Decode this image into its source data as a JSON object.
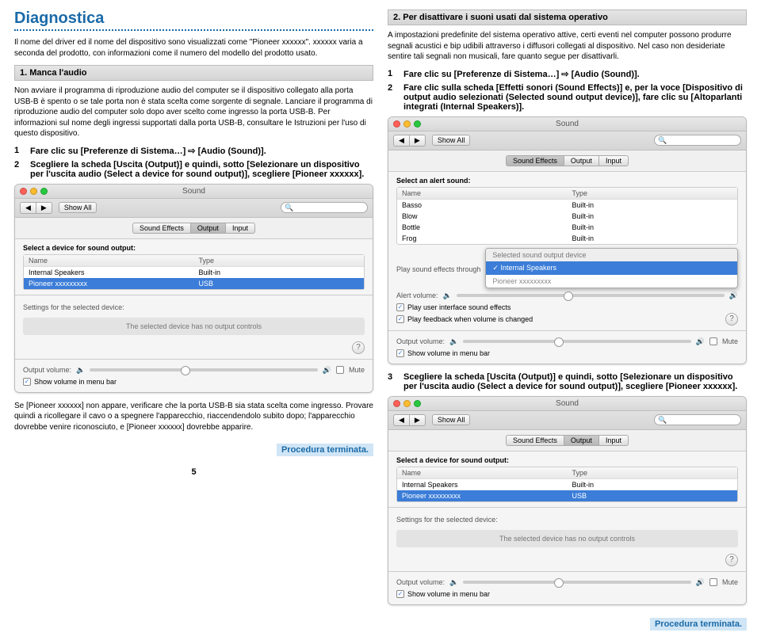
{
  "left": {
    "title": "Diagnostica",
    "intro": "Il nome del driver ed il nome del dispositivo sono visualizzati come \"Pioneer xxxxxx\". xxxxxx varia a seconda del prodotto, con informazioni come il numero del modello del prodotto usato.",
    "section1_title": "1. Manca l'audio",
    "section1_body": "Non avviare il programma di riproduzione audio del computer se il dispositivo collegato alla porta USB-B è spento o se tale porta non è stata scelta come sorgente di segnale. Lanciare il programma di riproduzione audio del computer solo dopo aver scelto come ingresso la porta USB-B. Per informazioni sul nome degli ingressi supportati dalla porta USB-B, consultare le Istruzioni per l'uso di questo dispositivo.",
    "step1": "Fare clic su [Preferenze di Sistema…] ⇨ [Audio (Sound)].",
    "step2": "Scegliere la scheda [Uscita (Output)] e quindi, sotto [Selezionare un dispositivo per l'uscita audio (Select a device for sound output)], scegliere [Pioneer xxxxxx].",
    "bottom_note": "Se [Pioneer xxxxxx] non appare, verificare che la porta USB-B sia stata scelta come ingresso. Provare quindi a ricollegare il cavo o a spegnere l'apparecchio, riaccendendolo subito dopo; l'apparecchio dovrebbe venire riconosciuto, e [Pioneer xxxxxx] dovrebbe apparire."
  },
  "right": {
    "section2_title": "2. Per disattivare i suoni usati dal sistema operativo",
    "section2_body": "A impostazioni predefinite del sistema operativo attive, certi eventi nel computer possono produrre segnali acustici e bip udibili attraverso i diffusori collegati al dispositivo. Nel caso non desideriate sentire tali segnali non musicali, fare quanto segue per disattivarli.",
    "r_step1": "Fare clic su [Preferenze di Sistema…] ⇨ [Audio (Sound)].",
    "r_step2": "Fare clic sulla scheda [Effetti sonori (Sound Effects)] e, per la voce [Dispositivo di output audio selezionati (Selected sound output device)], fare clic su [Altoparlanti integrati (Internal Speakers)].",
    "r_step3": "Scegliere la scheda [Uscita (Output)] e quindi, sotto [Selezionare un dispositivo per l'uscita audio (Select a device for sound output)], scegliere [Pioneer xxxxxx]."
  },
  "mac": {
    "window_title": "Sound",
    "show_all": "Show All",
    "tabs": {
      "effects": "Sound Effects",
      "output": "Output",
      "input": "Input"
    },
    "select_device": "Select a device for sound output:",
    "th_name": "Name",
    "th_type": "Type",
    "row1_name": "Internal Speakers",
    "row1_type": "Built-in",
    "row2_name": "Pioneer xxxxxxxxx",
    "row2_type": "USB",
    "settings_label": "Settings for the selected device:",
    "no_controls": "The selected device has no output controls",
    "out_vol": "Output volume:",
    "mute": "Mute",
    "show_menubar": "Show volume in menu bar",
    "alert_label": "Select an alert sound:",
    "alert_basso": "Basso",
    "alert_blow": "Blow",
    "alert_bottle": "Bottle",
    "alert_frog": "Frog",
    "builtin": "Built-in",
    "play_through": "Play sound effects through",
    "alert_vol": "Alert volume:",
    "ui_sounds": "Play user interface sound effects",
    "feedback": "Play feedback when volume is changed",
    "popup_title": "Selected sound output device",
    "popup_sel": "✓ Internal Speakers",
    "popup_dim": "Pioneer xxxxxxxxx",
    "nav_back": "◀",
    "nav_fwd": "▶",
    "search_icon": "🔍"
  },
  "done": "Procedura terminata.",
  "page_num": "5"
}
